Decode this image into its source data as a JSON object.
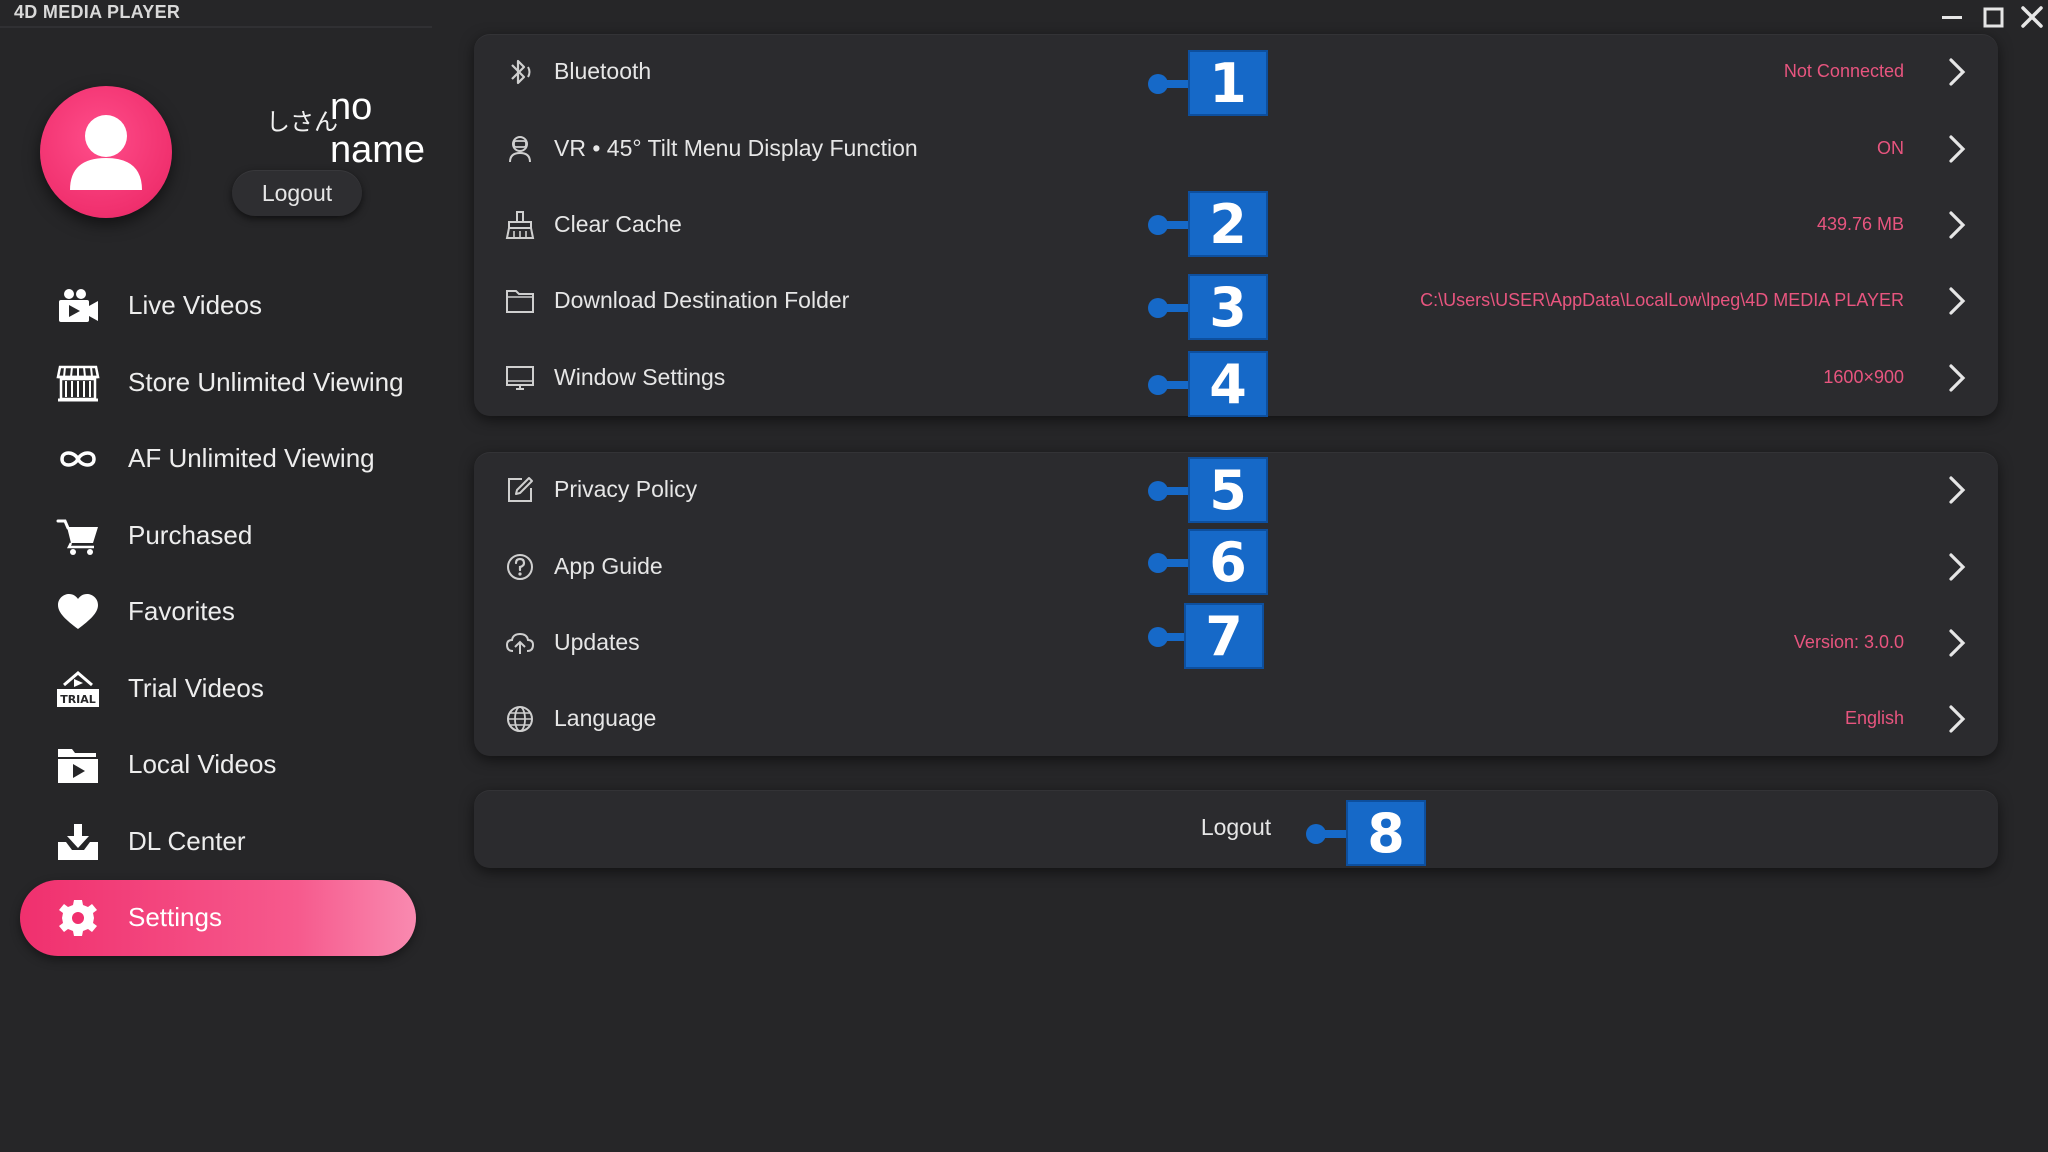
{
  "window": {
    "title": "4D MEDIA PLAYER",
    "controls": [
      "minimize-icon",
      "maximize-icon",
      "close-icon"
    ]
  },
  "user": {
    "prefix": "しさん",
    "name": "no name",
    "logout_label": "Logout"
  },
  "sidebar": {
    "items": [
      {
        "label": "Live Videos",
        "icon": "video-camera-icon",
        "active": false
      },
      {
        "label": "Store Unlimited Viewing",
        "icon": "store-icon",
        "active": false
      },
      {
        "label": "AF Unlimited Viewing",
        "icon": "infinity-icon",
        "active": false
      },
      {
        "label": "Purchased",
        "icon": "cart-icon",
        "active": false
      },
      {
        "label": "Favorites",
        "icon": "heart-icon",
        "active": false
      },
      {
        "label": "Trial Videos",
        "icon": "trial-icon",
        "active": false,
        "icon_text": "TRIAL"
      },
      {
        "label": "Local Videos",
        "icon": "local-folder-icon",
        "active": false
      },
      {
        "label": "DL Center",
        "icon": "download-icon",
        "active": false
      },
      {
        "label": "Settings",
        "icon": "gear-icon",
        "active": true
      }
    ]
  },
  "settings": {
    "group1": [
      {
        "label": "Bluetooth",
        "value": "Not Connected",
        "icon": "bluetooth-icon",
        "callout": "1"
      },
      {
        "label": "VR • 45° Tilt Menu Display Function",
        "value": "ON",
        "icon": "vr-headset-icon",
        "callout": ""
      },
      {
        "label": "Clear Cache",
        "value": "439.76 MB",
        "icon": "broom-icon",
        "callout": "2"
      },
      {
        "label": "Download Destination Folder",
        "value": "C:\\Users\\USER\\AppData\\LocalLow\\lpeg\\4D MEDIA PLAYER",
        "icon": "folder-icon",
        "callout": "3"
      },
      {
        "label": "Window Settings",
        "value": "1600×900",
        "icon": "monitor-icon",
        "callout": "4"
      }
    ],
    "group2": [
      {
        "label": "Privacy Policy",
        "value": "",
        "icon": "edit-document-icon",
        "callout": "5"
      },
      {
        "label": "App Guide",
        "value": "",
        "icon": "help-circle-icon",
        "callout": "6"
      },
      {
        "label": "Updates",
        "value": "Version: 3.0.0",
        "icon": "cloud-upload-icon",
        "callout": "7"
      },
      {
        "label": "Language",
        "value": "English",
        "icon": "globe-icon",
        "callout": ""
      }
    ],
    "logout_label": "Logout",
    "logout_callout": "8"
  },
  "colors": {
    "background": "#262628",
    "panel": "#2b2b2e",
    "accent_pink": "#f0306e",
    "value_pink": "#e8557f",
    "callout_blue": "#1669c8"
  }
}
